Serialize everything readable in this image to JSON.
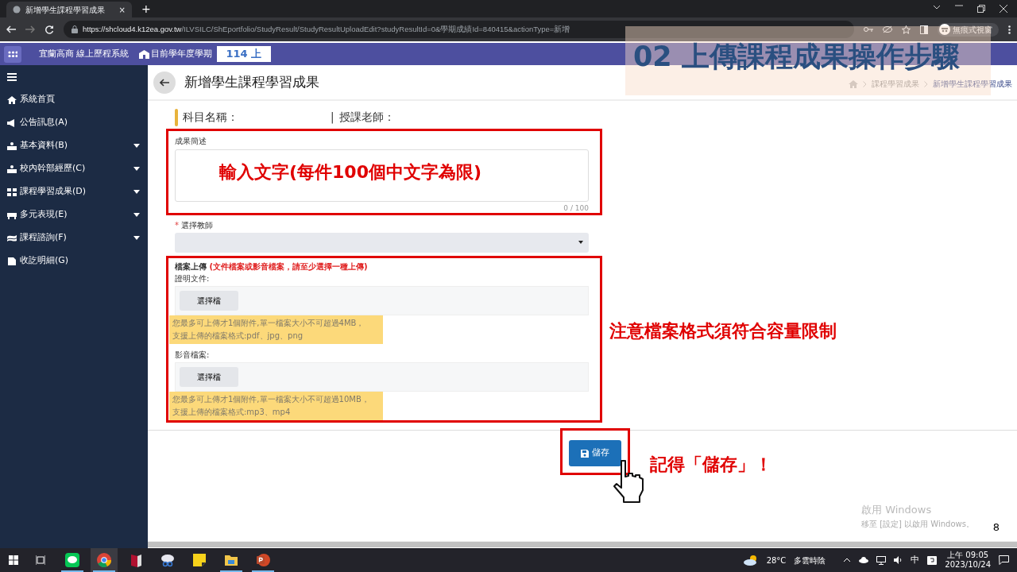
{
  "browser": {
    "tab_title": "新增學生課程學習成果",
    "tab_close": "×",
    "new_tab": "+",
    "url_host": "https://shcloud4.k12ea.gov.tw",
    "url_path": "/ILVSILC/ShEportfolio/StudyResult/StudyResultUploadEdit?studyResultId=0&學期成績Id=840415&actionType=新增",
    "profile": "無痕式視窗"
  },
  "navbar": {
    "school": "宜蘭高商 線上歷程系統",
    "term_label": "目前學年度學期",
    "term": "114 上"
  },
  "sidebar": {
    "items": [
      {
        "label": "系統首頁",
        "expandable": false
      },
      {
        "label": "公告訊息(A)",
        "expandable": false
      },
      {
        "label": "基本資料(B)",
        "expandable": true
      },
      {
        "label": "校內幹部經歷(C)",
        "expandable": true
      },
      {
        "label": "課程學習成果(D)",
        "expandable": true
      },
      {
        "label": "多元表現(E)",
        "expandable": true
      },
      {
        "label": "課程諮詢(F)",
        "expandable": true
      },
      {
        "label": "收訖明細(G)",
        "expandable": false
      }
    ]
  },
  "page": {
    "title": "新增學生課程學習成果",
    "breadcrumbs": [
      "課程學習成果",
      "新增學生課程學習成果"
    ],
    "subject_label": "科目名稱：",
    "separator": "|",
    "teacher_label": "授課老師：",
    "description": {
      "label": "成果簡述",
      "counter": "0 / 100"
    },
    "teacher_select": {
      "required_mark": "*",
      "label": "選擇教師"
    },
    "upload": {
      "label": "檔案上傳",
      "note": "(文件檔案或影音檔案，請至少選擇一種上傳)",
      "groups": [
        {
          "label": "證明文件:",
          "button": "選擇檔",
          "hint": "您最多可上傳才1個附件,單一檔案大小不可超過4MB，",
          "formats": "支援上傳的檔案格式:pdf、jpg、png"
        },
        {
          "label": "影音檔案:",
          "button": "選擇檔",
          "hint": "您最多可上傳才1個附件,單一檔案大小不可超過10MB，",
          "formats": "支援上傳的檔案格式:mp3、mp4"
        }
      ]
    },
    "save_button": "儲存"
  },
  "annotations": {
    "title": "02 上傳課程成果操作步驟",
    "text_input": "輸入文字(每件100個中文字為限)",
    "file_note": "注意檔案格式須符合容量限制",
    "save_note": "記得「儲存」！"
  },
  "activation": {
    "title": "啟用 Windows",
    "text": "移至 [設定] 以啟用 Windows。"
  },
  "slide_number": "8",
  "taskbar": {
    "apps": [
      {
        "kind": "line",
        "running": true,
        "active": false
      },
      {
        "kind": "chrome",
        "running": true,
        "active": true
      },
      {
        "kind": "book",
        "running": false,
        "active": false
      },
      {
        "kind": "snip",
        "running": false,
        "active": false
      },
      {
        "kind": "note",
        "running": false,
        "active": false
      },
      {
        "kind": "folder",
        "running": true,
        "active": false
      },
      {
        "kind": "powerpoint",
        "running": true,
        "active": false
      }
    ],
    "weather": "28°C",
    "weather_text": "多雲時陰",
    "ime": "中",
    "time": "上午 09:05",
    "date": "2023/10/24"
  }
}
